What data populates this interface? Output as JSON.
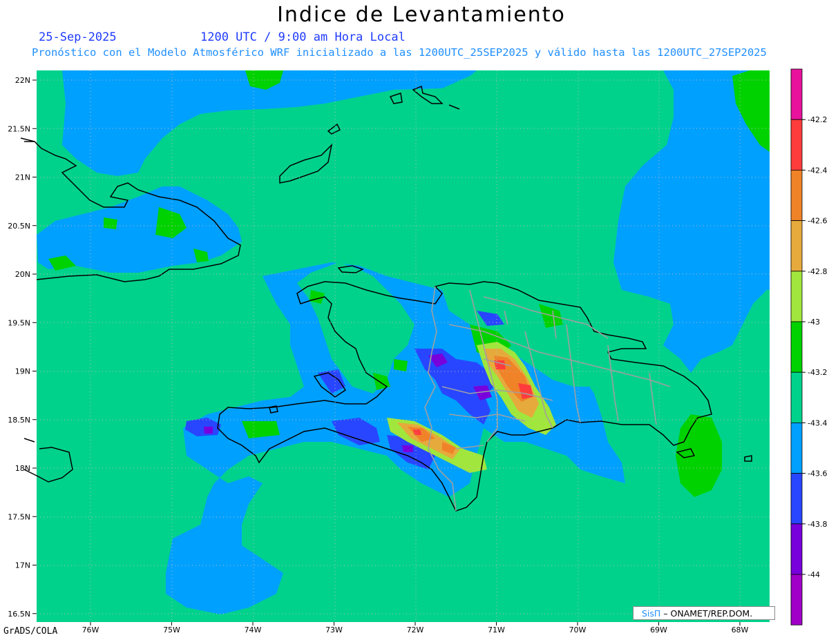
{
  "title": "Indice de Levantamiento",
  "date": "25-Sep-2025",
  "time_label": "1200 UTC / 9:00 am Hora Local",
  "subtitle": "Pronóstico con el Modelo Atmosférico WRF inicializado a las 1200UTC_25SEP2025 y válido hasta las  1200UTC_27SEP2025",
  "footer_left": "GrADS/COLA",
  "credit": {
    "brand": "SisΠ",
    "text": "– ONAMET/REP.DOM."
  },
  "lat_labels": [
    "22N",
    "21.5N",
    "21N",
    "20.5N",
    "20N",
    "19.5N",
    "19N",
    "18.5N",
    "18N",
    "17.5N",
    "17N",
    "16.5N"
  ],
  "lon_labels": [
    "76W",
    "75W",
    "74W",
    "73W",
    "72W",
    "71W",
    "70W",
    "69W",
    "68W"
  ],
  "colorbar": {
    "labels": [
      "-42.2",
      "-42.4",
      "-42.6",
      "-42.8",
      "-43",
      "-43.2",
      "-43.4",
      "-43.6",
      "-43.8",
      "-44"
    ],
    "colors": [
      "#e8129c",
      "#ff3c3c",
      "#f08228",
      "#e6aa3c",
      "#a0e63c",
      "#00d200",
      "#00d28c",
      "#00a0ff",
      "#2846ff",
      "#7800dc",
      "#a000c8"
    ]
  },
  "colors": {
    "ocean_blue": "#00a0ff",
    "teal": "#00d28c",
    "green": "#00d200",
    "coast": "#000000",
    "border": "#a0a0a0"
  }
}
